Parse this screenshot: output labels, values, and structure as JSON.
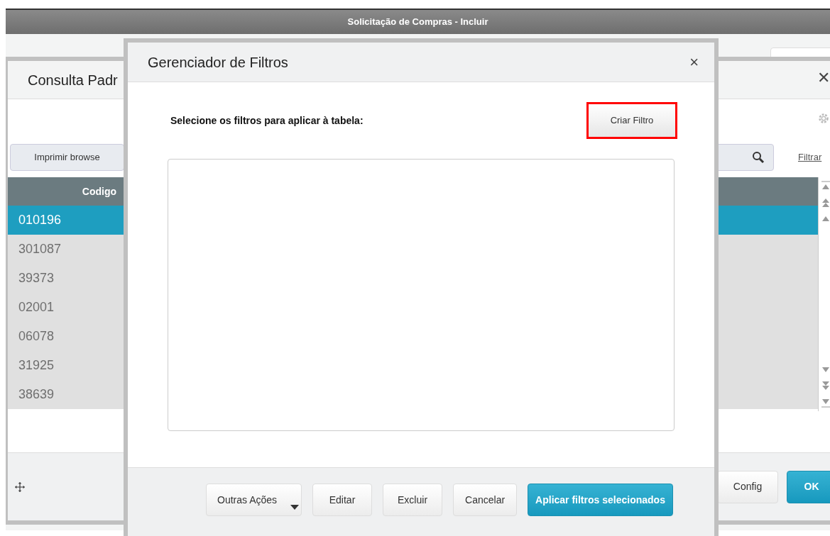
{
  "window": {
    "title": "Solicitação de Compras - Incluir"
  },
  "back_dialog": {
    "title": "Consulta Padr",
    "close": "✕",
    "print_button": "Imprimir browse",
    "filter_link": "Filtrar",
    "table": {
      "columns": [
        "Codigo"
      ],
      "rows": [
        {
          "code": "010196",
          "selected": true
        },
        {
          "code": "301087",
          "selected": false
        },
        {
          "code": "39373",
          "selected": false
        },
        {
          "code": "02001",
          "selected": false
        },
        {
          "code": "06078",
          "selected": false
        },
        {
          "code": "31925",
          "selected": false
        },
        {
          "code": "38639",
          "selected": false
        }
      ]
    },
    "buttons": [
      {
        "label": "Config",
        "kind": "default"
      },
      {
        "label": "OK",
        "kind": "primary"
      }
    ]
  },
  "modal": {
    "title": "Gerenciador de Filtros",
    "close": "×",
    "instruction": "Selecione os filtros para aplicar à tabela:",
    "create_button": {
      "label": "Criar Filtro",
      "highlighted": true
    },
    "buttons": [
      {
        "label": "Outras Ações",
        "kind": "dropdown"
      },
      {
        "label": "Editar",
        "kind": "default"
      },
      {
        "label": "Excluir",
        "kind": "default"
      },
      {
        "label": "Cancelar",
        "kind": "default"
      },
      {
        "label": "Aplicar filtros selecionados",
        "kind": "primary"
      }
    ]
  }
}
